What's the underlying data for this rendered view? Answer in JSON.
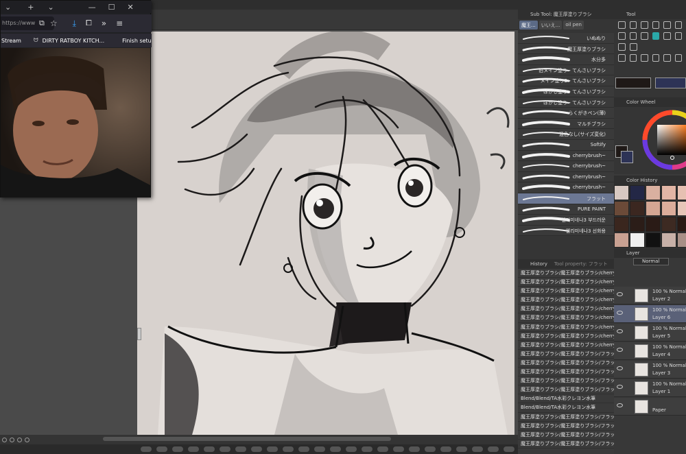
{
  "browser": {
    "url": "https://www",
    "bookmarks": [
      "Stream",
      "DIRTY RATBOY KITCH...",
      "Finish setup"
    ],
    "controls": [
      "+",
      "⌄",
      "—",
      "☐",
      "✕"
    ]
  },
  "subtool": {
    "title": "Sub Tool: 魔王厚塗りブラシ",
    "tabs": [
      "魔王...",
      "いいえ...",
      "oil pen"
    ],
    "brushes": [
      "いぬぬり",
      "魔王厚塗りブラシ",
      "水分多",
      "旧メイン塗り・てんさいブラシ",
      "メイン塗り2・てんさいブラシ",
      "ぼかし塗り・てんさいブラシ",
      "ぼかし塗り・てんさいブラシ",
      "らくがきペン(薄)",
      "マルチブラシ",
      "混色なし(サイズ変化)",
      "Softify",
      "cherrybrush~",
      "cherrybrush~",
      "cherrybrush~",
      "cherrybrush~",
      "フラット",
      "PURE PAINT",
      "엘리미네나3 부드러운",
      "엘리미네나3 선화용"
    ],
    "selected_index": 15
  },
  "history": {
    "tabs": [
      "History",
      "Tool property: フラット"
    ],
    "items": [
      "魔王厚塗りブラシ/魔王厚塗りブラシ/cherrybrush~",
      "魔王厚塗りブラシ/魔王厚塗りブラシ/cherrybrush~",
      "魔王厚塗りブラシ/魔王厚塗りブラシ/cherrybrush~",
      "魔王厚塗りブラシ/魔王厚塗りブラシ/cherrybrush~",
      "魔王厚塗りブラシ/魔王厚塗りブラシ/cherrybrush~",
      "魔王厚塗りブラシ/魔王厚塗りブラシ/cherrybrush~",
      "魔王厚塗りブラシ/魔王厚塗りブラシ/cherrybrush~",
      "魔王厚塗りブラシ/魔王厚塗りブラシ/cherrybrush~",
      "魔王厚塗りブラシ/魔王厚塗りブラシ/cherrybrush~",
      "魔王厚塗りブラシ/魔王厚塗りブラシ/フラット",
      "魔王厚塗りブラシ/魔王厚塗りブラシ/フラット",
      "魔王厚塗りブラシ/魔王厚塗りブラシ/フラット",
      "魔王厚塗りブラシ/魔王厚塗りブラシ/フラット",
      "魔王厚塗りブラシ/魔王厚塗りブラシ/フラット",
      "Blend/Blend/TA水彩クレヨン水筆",
      "Blend/Blend/TA水彩クレヨン水筆",
      "魔王厚塗りブラシ/魔王厚塗りブラシ/フラット",
      "魔王厚塗りブラシ/魔王厚塗りブラシ/フラット",
      "魔王厚塗りブラシ/魔王厚塗りブラシ/フラット",
      "魔王厚塗りブラシ/魔王厚塗りブラシ/フラット"
    ]
  },
  "tool": {
    "title": "Tool"
  },
  "colorwheel": {
    "title": "Color Wheel"
  },
  "colorhistory": {
    "title": "Color History",
    "swatches": [
      "#d8c9c2",
      "#232746",
      "#d9b0a0",
      "#e2b5a5",
      "#e6c0b2",
      "#6b4a38",
      "#3b2720",
      "#d4a693",
      "#dcad9b",
      "#e7c6b8",
      "#3a261e",
      "#2b1d18",
      "#2a1b16",
      "#3d2a22",
      "#2a1a14",
      "#c9a192",
      "#f0f0f0",
      "#111111",
      "#c8b1a8",
      "#a88f86"
    ]
  },
  "layer": {
    "title": "Layer",
    "blend_mode": "Normal",
    "layers": [
      {
        "mode": "100 % Normal",
        "name": "Layer 2"
      },
      {
        "mode": "100 % Normal",
        "name": "Layer 6"
      },
      {
        "mode": "100 % Normal",
        "name": "Layer 5"
      },
      {
        "mode": "100 % Normal",
        "name": "Layer 4"
      },
      {
        "mode": "100 % Normal",
        "name": "Layer 3"
      },
      {
        "mode": "100 % Normal",
        "name": "Layer 1"
      },
      {
        "mode": "",
        "name": "Paper"
      }
    ],
    "selected_index": 1
  }
}
